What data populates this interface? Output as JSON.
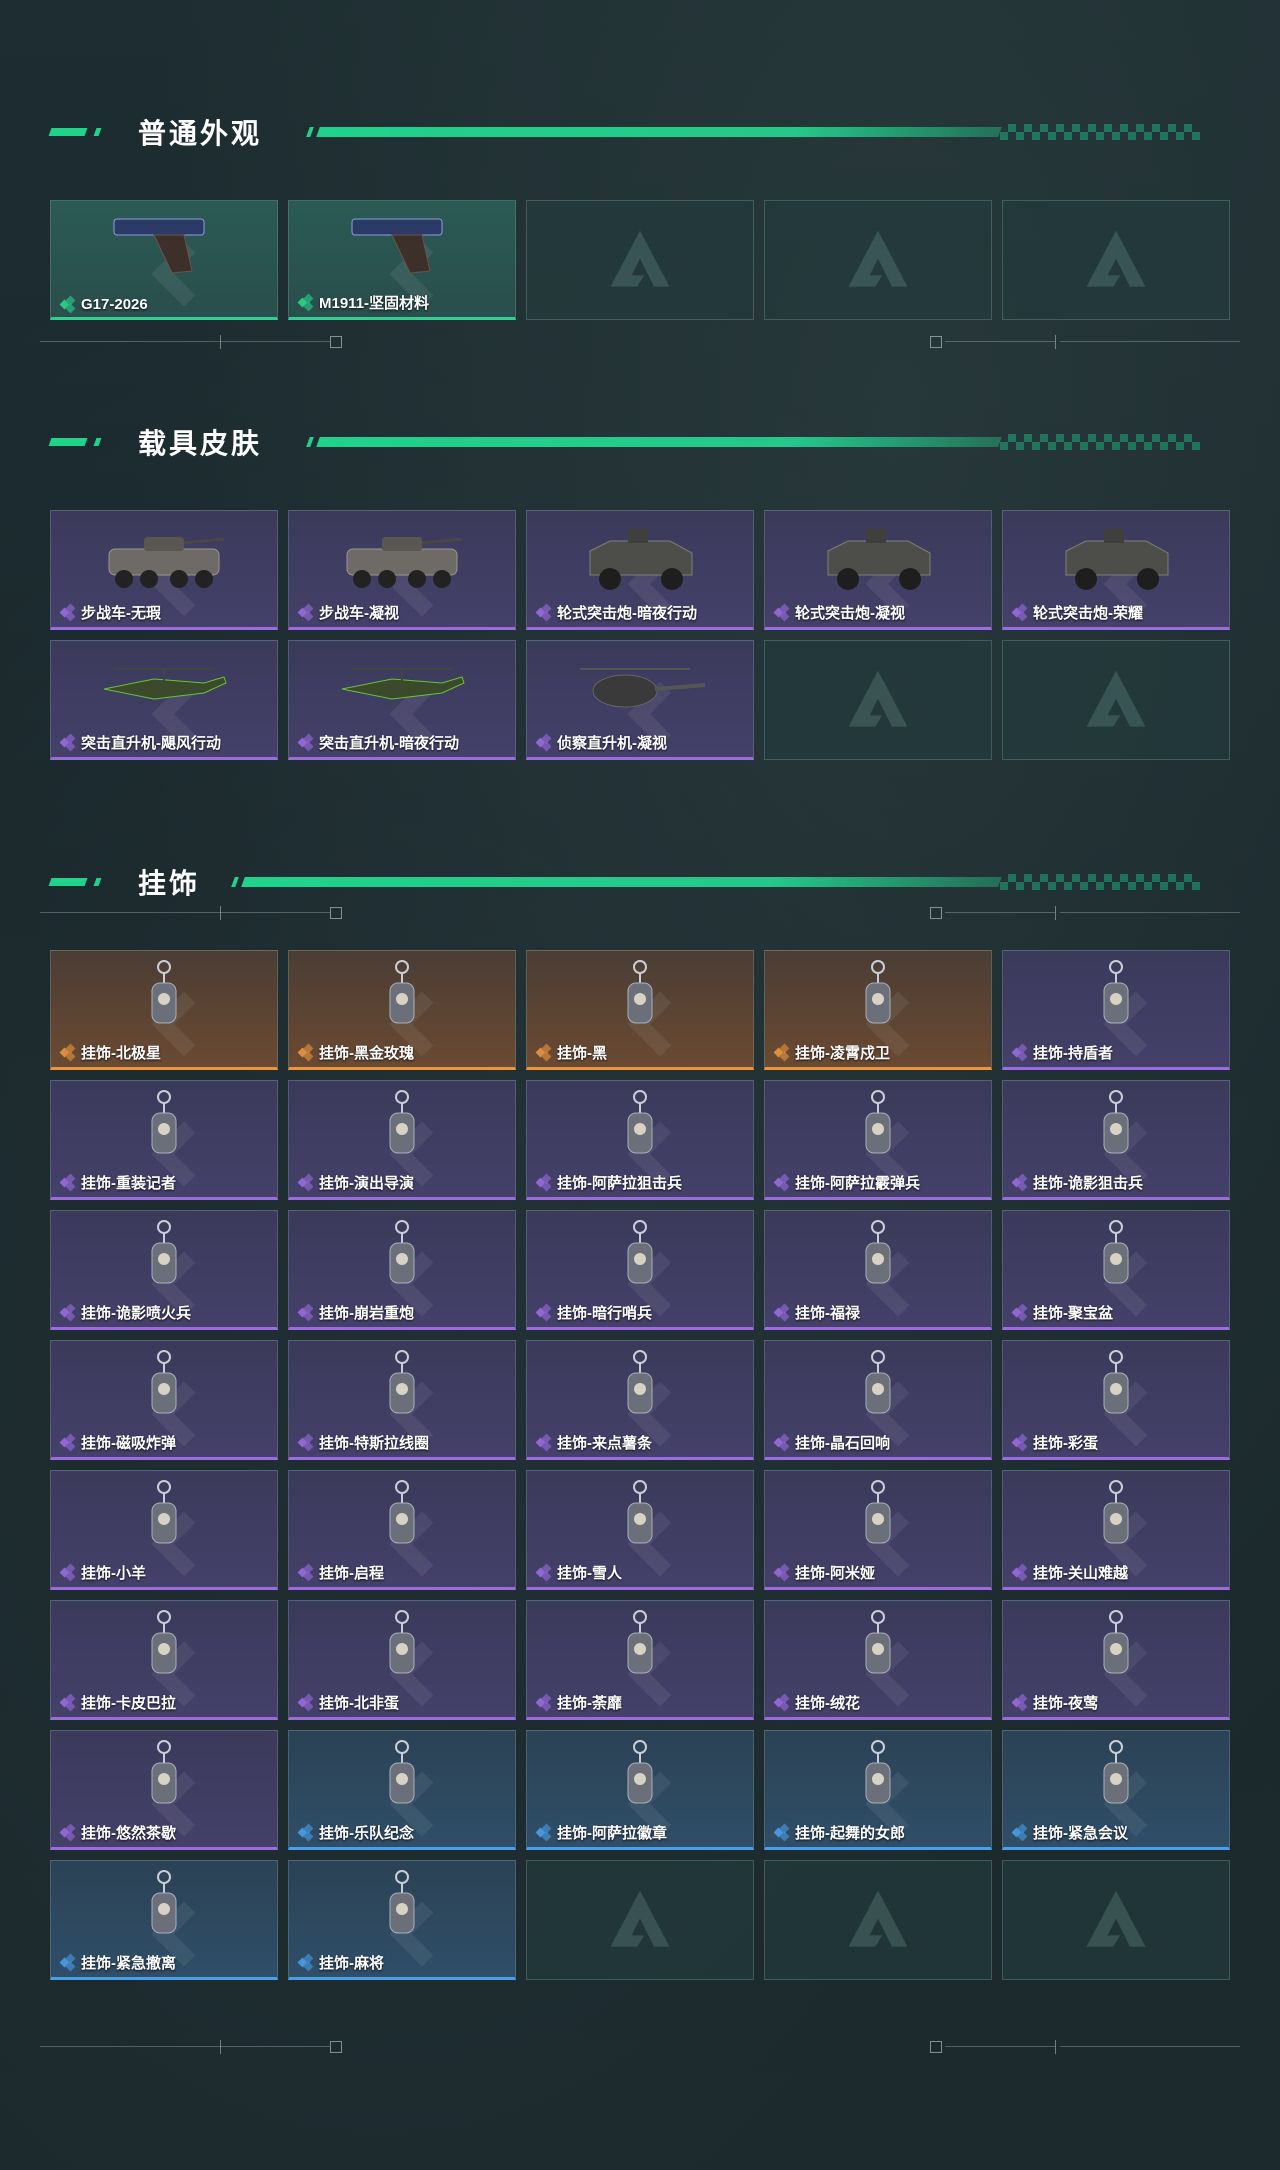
{
  "sections": [
    {
      "title": "普通外观",
      "items": [
        {
          "label": "G17-2026",
          "rarity": "green",
          "icon": "pistol-icon"
        },
        {
          "label": "M1911-坚固材料",
          "rarity": "green",
          "icon": "pistol-icon"
        },
        {
          "label": "",
          "rarity": "empty"
        },
        {
          "label": "",
          "rarity": "empty"
        },
        {
          "label": "",
          "rarity": "empty"
        }
      ]
    },
    {
      "title": "载具皮肤",
      "items": [
        {
          "label": "步战车-无瑕",
          "rarity": "purple",
          "icon": "armored-vehicle-icon"
        },
        {
          "label": "步战车-凝视",
          "rarity": "purple",
          "icon": "armored-vehicle-icon"
        },
        {
          "label": "轮式突击炮-暗夜行动",
          "rarity": "purple",
          "icon": "assault-vehicle-icon"
        },
        {
          "label": "轮式突击炮-凝视",
          "rarity": "purple",
          "icon": "assault-vehicle-icon"
        },
        {
          "label": "轮式突击炮-荣耀",
          "rarity": "purple",
          "icon": "assault-vehicle-icon"
        },
        {
          "label": "突击直升机-飓风行动",
          "rarity": "purple",
          "icon": "attack-helicopter-icon"
        },
        {
          "label": "突击直升机-暗夜行动",
          "rarity": "purple",
          "icon": "attack-helicopter-icon"
        },
        {
          "label": "侦察直升机-凝视",
          "rarity": "purple",
          "icon": "scout-helicopter-icon"
        },
        {
          "label": "",
          "rarity": "empty"
        },
        {
          "label": "",
          "rarity": "empty"
        }
      ]
    },
    {
      "title": "挂饰",
      "items": [
        {
          "label": "挂饰-北极星",
          "rarity": "orange",
          "icon": "charm-icon"
        },
        {
          "label": "挂饰-黑金玫瑰",
          "rarity": "orange",
          "icon": "charm-icon"
        },
        {
          "label": "挂饰-黑",
          "rarity": "orange",
          "icon": "charm-icon"
        },
        {
          "label": "挂饰-凌霄戍卫",
          "rarity": "orange",
          "icon": "charm-icon"
        },
        {
          "label": "挂饰-持盾者",
          "rarity": "purple",
          "icon": "charm-icon"
        },
        {
          "label": "挂饰-重装记者",
          "rarity": "purple",
          "icon": "charm-icon"
        },
        {
          "label": "挂饰-演出导演",
          "rarity": "purple",
          "icon": "charm-icon"
        },
        {
          "label": "挂饰-阿萨拉狙击兵",
          "rarity": "purple",
          "icon": "charm-icon"
        },
        {
          "label": "挂饰-阿萨拉霰弹兵",
          "rarity": "purple",
          "icon": "charm-icon"
        },
        {
          "label": "挂饰-诡影狙击兵",
          "rarity": "purple",
          "icon": "charm-icon"
        },
        {
          "label": "挂饰-诡影喷火兵",
          "rarity": "purple",
          "icon": "charm-icon"
        },
        {
          "label": "挂饰-崩岩重炮",
          "rarity": "purple",
          "icon": "charm-icon"
        },
        {
          "label": "挂饰-暗行哨兵",
          "rarity": "purple",
          "icon": "charm-icon"
        },
        {
          "label": "挂饰-福禄",
          "rarity": "purple",
          "icon": "charm-icon"
        },
        {
          "label": "挂饰-聚宝盆",
          "rarity": "purple",
          "icon": "charm-icon"
        },
        {
          "label": "挂饰-磁吸炸弹",
          "rarity": "purple",
          "icon": "charm-icon"
        },
        {
          "label": "挂饰-特斯拉线圈",
          "rarity": "purple",
          "icon": "charm-icon"
        },
        {
          "label": "挂饰-来点薯条",
          "rarity": "purple",
          "icon": "charm-icon"
        },
        {
          "label": "挂饰-晶石回响",
          "rarity": "purple",
          "icon": "charm-icon"
        },
        {
          "label": "挂饰-彩蛋",
          "rarity": "purple",
          "icon": "charm-icon"
        },
        {
          "label": "挂饰-小羊",
          "rarity": "purple",
          "icon": "charm-icon"
        },
        {
          "label": "挂饰-启程",
          "rarity": "purple",
          "icon": "charm-icon"
        },
        {
          "label": "挂饰-雪人",
          "rarity": "purple",
          "icon": "charm-icon"
        },
        {
          "label": "挂饰-阿米娅",
          "rarity": "purple",
          "icon": "charm-icon"
        },
        {
          "label": "挂饰-关山难越",
          "rarity": "purple",
          "icon": "charm-icon"
        },
        {
          "label": "挂饰-卡皮巴拉",
          "rarity": "purple",
          "icon": "charm-icon"
        },
        {
          "label": "挂饰-北非蛋",
          "rarity": "purple",
          "icon": "charm-icon"
        },
        {
          "label": "挂饰-荼靡",
          "rarity": "purple",
          "icon": "charm-icon"
        },
        {
          "label": "挂饰-绒花",
          "rarity": "purple",
          "icon": "charm-icon"
        },
        {
          "label": "挂饰-夜莺",
          "rarity": "purple",
          "icon": "charm-icon"
        },
        {
          "label": "挂饰-悠然茶歇",
          "rarity": "purple",
          "icon": "charm-icon"
        },
        {
          "label": "挂饰-乐队纪念",
          "rarity": "blue",
          "icon": "charm-icon"
        },
        {
          "label": "挂饰-阿萨拉徽章",
          "rarity": "blue",
          "icon": "charm-icon"
        },
        {
          "label": "挂饰-起舞的女郎",
          "rarity": "blue",
          "icon": "charm-icon"
        },
        {
          "label": "挂饰-紧急会议",
          "rarity": "blue",
          "icon": "charm-icon"
        },
        {
          "label": "挂饰-紧急撤离",
          "rarity": "blue",
          "icon": "charm-icon"
        },
        {
          "label": "挂饰-麻将",
          "rarity": "blue",
          "icon": "charm-icon"
        },
        {
          "label": "",
          "rarity": "empty"
        },
        {
          "label": "",
          "rarity": "empty"
        },
        {
          "label": "",
          "rarity": "empty"
        }
      ]
    }
  ],
  "colors": {
    "accent": "#21d38a",
    "green": "#2ad48e",
    "purple": "#9a6ce0",
    "orange": "#e9963f",
    "blue": "#4a9fe8"
  }
}
